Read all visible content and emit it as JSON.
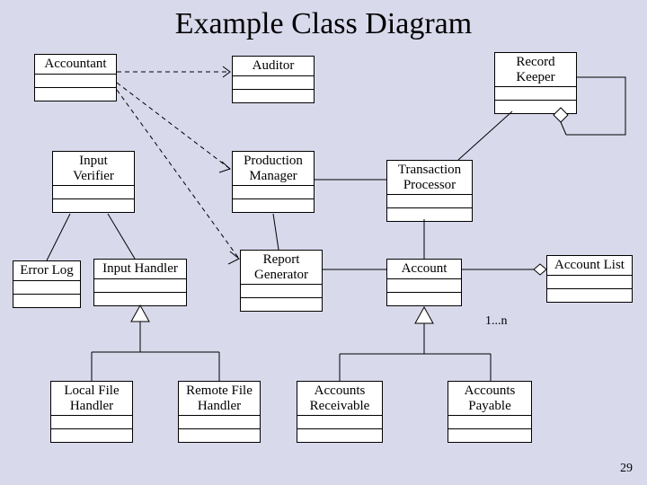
{
  "title": "Example Class Diagram",
  "page_number": "29",
  "multiplicity_label": "1...n",
  "classes": {
    "accountant": "Accountant",
    "auditor": "Auditor",
    "record_keeper": "Record\nKeeper",
    "input_verifier": "Input\nVerifier",
    "production_manager": "Production\nManager",
    "transaction_processor": "Transaction\nProcessor",
    "error_log": "Error Log",
    "input_handler": "Input Handler",
    "report_generator": "Report\nGenerator",
    "account": "Account",
    "account_list": "Account List",
    "local_file_handler": "Local File\nHandler",
    "remote_file_handler": "Remote File\nHandler",
    "accounts_receivable": "Accounts\nReceivable",
    "accounts_payable": "Accounts\nPayable"
  }
}
